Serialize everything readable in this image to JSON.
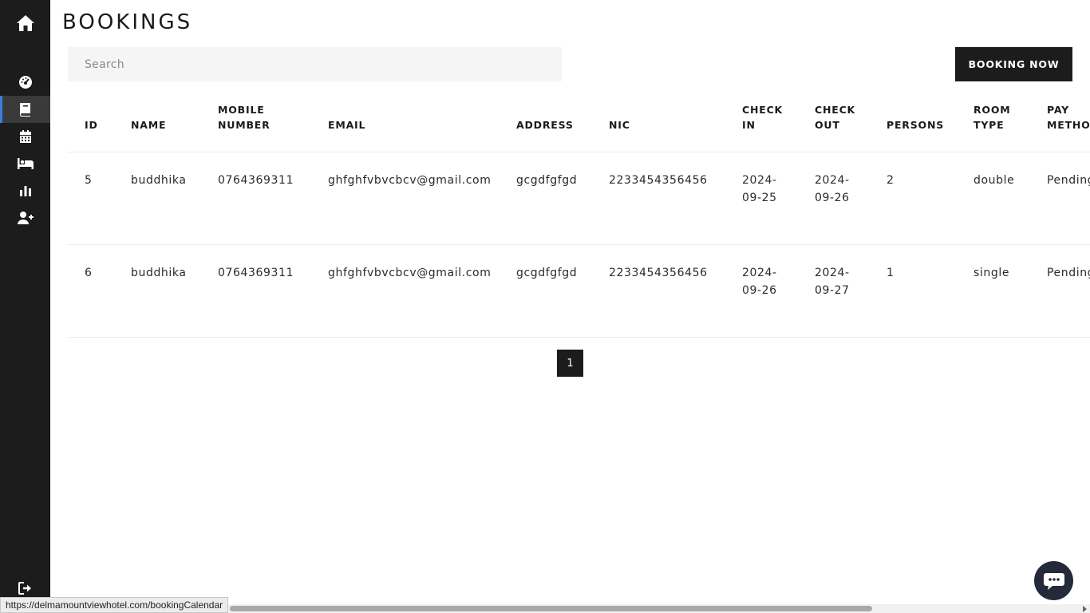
{
  "page": {
    "title": "BOOKINGS"
  },
  "sidebar": {
    "items": [
      {
        "icon": "home-icon",
        "label": "Home"
      },
      {
        "icon": "dashboard-icon",
        "label": "Dashboard"
      },
      {
        "icon": "book-icon",
        "label": "Bookings",
        "active": true
      },
      {
        "icon": "calendar-icon",
        "label": "Booking Calendar"
      },
      {
        "icon": "bed-icon",
        "label": "Rooms"
      },
      {
        "icon": "chart-bar-icon",
        "label": "Reports"
      },
      {
        "icon": "user-plus-icon",
        "label": "Add User"
      },
      {
        "icon": "sign-out-icon",
        "label": "Logout"
      }
    ]
  },
  "search": {
    "placeholder": "Search",
    "value": ""
  },
  "toolbar": {
    "booking_now_label": "BOOKING NOW"
  },
  "table": {
    "headers": [
      "ID",
      "NAME",
      "MOBILE NUMBER",
      "EMAIL",
      "ADDRESS",
      "NIC",
      "CHECK IN",
      "CHECK OUT",
      "PERSONS",
      "ROOM TYPE",
      "PAY METHOD"
    ],
    "rows": [
      [
        "5",
        "buddhika",
        "0764369311",
        "ghfghfvbvcbcv@gmail.com",
        "gcgdfgfgd",
        "2233454356456",
        "2024-09-25",
        "2024-09-26",
        "2",
        "double",
        "Pending"
      ],
      [
        "6",
        "buddhika",
        "0764369311",
        "ghfghfvbvcbcv@gmail.com",
        "gcgdfgfgd",
        "2233454356456",
        "2024-09-26",
        "2024-09-27",
        "1",
        "single",
        "Pending"
      ]
    ]
  },
  "pagination": {
    "current_page": "1"
  },
  "status_bar": {
    "url": "https://delmamountviewhotel.com/bookingCalendar"
  },
  "colors": {
    "sidebar_bg": "#1c1c1c",
    "active_accent": "#3b7ddd",
    "button_bg": "#1c1c1c",
    "chat_bg": "#252a3a"
  }
}
